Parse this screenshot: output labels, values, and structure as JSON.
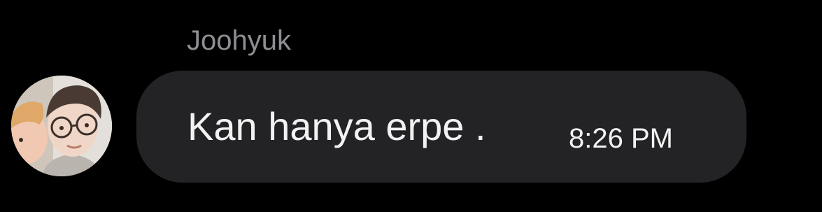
{
  "message": {
    "sender": "Joohyuk",
    "text": "Kan hanya erpe .",
    "time": "8:26 PM",
    "avatar_icon": "avatar-photo"
  },
  "colors": {
    "background": "#000000",
    "bubble": "#232326",
    "sender_name": "#8e8e93",
    "text": "#f2f2f2"
  }
}
